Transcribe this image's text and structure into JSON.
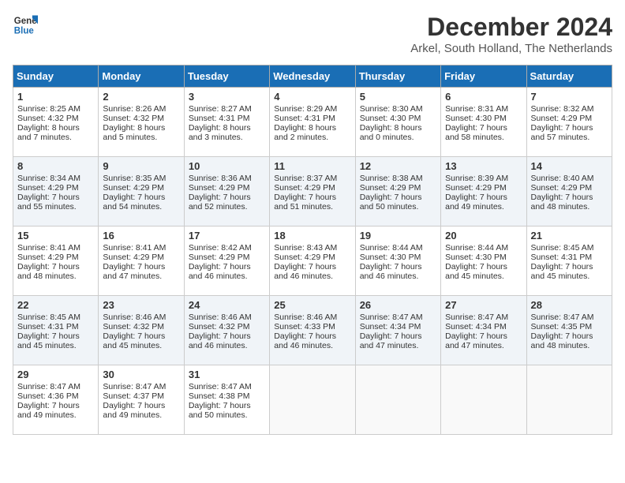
{
  "header": {
    "logo_line1": "General",
    "logo_line2": "Blue",
    "month": "December 2024",
    "location": "Arkel, South Holland, The Netherlands"
  },
  "days_of_week": [
    "Sunday",
    "Monday",
    "Tuesday",
    "Wednesday",
    "Thursday",
    "Friday",
    "Saturday"
  ],
  "weeks": [
    [
      {
        "day": "1",
        "sunrise": "8:25 AM",
        "sunset": "4:32 PM",
        "daylight": "8 hours and 7 minutes."
      },
      {
        "day": "2",
        "sunrise": "8:26 AM",
        "sunset": "4:32 PM",
        "daylight": "8 hours and 5 minutes."
      },
      {
        "day": "3",
        "sunrise": "8:27 AM",
        "sunset": "4:31 PM",
        "daylight": "8 hours and 3 minutes."
      },
      {
        "day": "4",
        "sunrise": "8:29 AM",
        "sunset": "4:31 PM",
        "daylight": "8 hours and 2 minutes."
      },
      {
        "day": "5",
        "sunrise": "8:30 AM",
        "sunset": "4:30 PM",
        "daylight": "8 hours and 0 minutes."
      },
      {
        "day": "6",
        "sunrise": "8:31 AM",
        "sunset": "4:30 PM",
        "daylight": "7 hours and 58 minutes."
      },
      {
        "day": "7",
        "sunrise": "8:32 AM",
        "sunset": "4:29 PM",
        "daylight": "7 hours and 57 minutes."
      }
    ],
    [
      {
        "day": "8",
        "sunrise": "8:34 AM",
        "sunset": "4:29 PM",
        "daylight": "7 hours and 55 minutes."
      },
      {
        "day": "9",
        "sunrise": "8:35 AM",
        "sunset": "4:29 PM",
        "daylight": "7 hours and 54 minutes."
      },
      {
        "day": "10",
        "sunrise": "8:36 AM",
        "sunset": "4:29 PM",
        "daylight": "7 hours and 52 minutes."
      },
      {
        "day": "11",
        "sunrise": "8:37 AM",
        "sunset": "4:29 PM",
        "daylight": "7 hours and 51 minutes."
      },
      {
        "day": "12",
        "sunrise": "8:38 AM",
        "sunset": "4:29 PM",
        "daylight": "7 hours and 50 minutes."
      },
      {
        "day": "13",
        "sunrise": "8:39 AM",
        "sunset": "4:29 PM",
        "daylight": "7 hours and 49 minutes."
      },
      {
        "day": "14",
        "sunrise": "8:40 AM",
        "sunset": "4:29 PM",
        "daylight": "7 hours and 48 minutes."
      }
    ],
    [
      {
        "day": "15",
        "sunrise": "8:41 AM",
        "sunset": "4:29 PM",
        "daylight": "7 hours and 48 minutes."
      },
      {
        "day": "16",
        "sunrise": "8:41 AM",
        "sunset": "4:29 PM",
        "daylight": "7 hours and 47 minutes."
      },
      {
        "day": "17",
        "sunrise": "8:42 AM",
        "sunset": "4:29 PM",
        "daylight": "7 hours and 46 minutes."
      },
      {
        "day": "18",
        "sunrise": "8:43 AM",
        "sunset": "4:29 PM",
        "daylight": "7 hours and 46 minutes."
      },
      {
        "day": "19",
        "sunrise": "8:44 AM",
        "sunset": "4:30 PM",
        "daylight": "7 hours and 46 minutes."
      },
      {
        "day": "20",
        "sunrise": "8:44 AM",
        "sunset": "4:30 PM",
        "daylight": "7 hours and 45 minutes."
      },
      {
        "day": "21",
        "sunrise": "8:45 AM",
        "sunset": "4:31 PM",
        "daylight": "7 hours and 45 minutes."
      }
    ],
    [
      {
        "day": "22",
        "sunrise": "8:45 AM",
        "sunset": "4:31 PM",
        "daylight": "7 hours and 45 minutes."
      },
      {
        "day": "23",
        "sunrise": "8:46 AM",
        "sunset": "4:32 PM",
        "daylight": "7 hours and 45 minutes."
      },
      {
        "day": "24",
        "sunrise": "8:46 AM",
        "sunset": "4:32 PM",
        "daylight": "7 hours and 46 minutes."
      },
      {
        "day": "25",
        "sunrise": "8:46 AM",
        "sunset": "4:33 PM",
        "daylight": "7 hours and 46 minutes."
      },
      {
        "day": "26",
        "sunrise": "8:47 AM",
        "sunset": "4:34 PM",
        "daylight": "7 hours and 47 minutes."
      },
      {
        "day": "27",
        "sunrise": "8:47 AM",
        "sunset": "4:34 PM",
        "daylight": "7 hours and 47 minutes."
      },
      {
        "day": "28",
        "sunrise": "8:47 AM",
        "sunset": "4:35 PM",
        "daylight": "7 hours and 48 minutes."
      }
    ],
    [
      {
        "day": "29",
        "sunrise": "8:47 AM",
        "sunset": "4:36 PM",
        "daylight": "7 hours and 49 minutes."
      },
      {
        "day": "30",
        "sunrise": "8:47 AM",
        "sunset": "4:37 PM",
        "daylight": "7 hours and 49 minutes."
      },
      {
        "day": "31",
        "sunrise": "8:47 AM",
        "sunset": "4:38 PM",
        "daylight": "7 hours and 50 minutes."
      },
      null,
      null,
      null,
      null
    ]
  ]
}
